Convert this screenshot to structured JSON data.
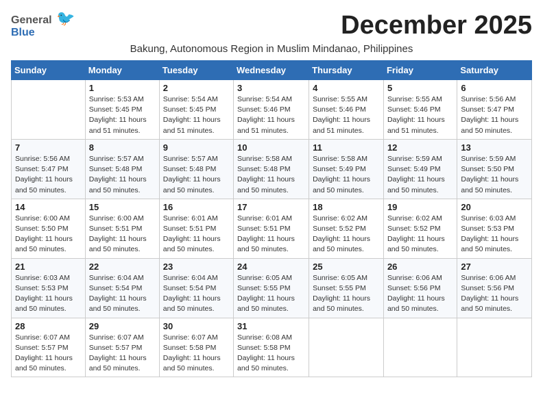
{
  "header": {
    "logo_general": "General",
    "logo_blue": "Blue",
    "month_title": "December 2025",
    "location": "Bakung, Autonomous Region in Muslim Mindanao, Philippines"
  },
  "days_of_week": [
    "Sunday",
    "Monday",
    "Tuesday",
    "Wednesday",
    "Thursday",
    "Friday",
    "Saturday"
  ],
  "weeks": [
    [
      {
        "day": "",
        "sunrise": "",
        "sunset": "",
        "daylight": ""
      },
      {
        "day": "1",
        "sunrise": "Sunrise: 5:53 AM",
        "sunset": "Sunset: 5:45 PM",
        "daylight": "Daylight: 11 hours and 51 minutes."
      },
      {
        "day": "2",
        "sunrise": "Sunrise: 5:54 AM",
        "sunset": "Sunset: 5:45 PM",
        "daylight": "Daylight: 11 hours and 51 minutes."
      },
      {
        "day": "3",
        "sunrise": "Sunrise: 5:54 AM",
        "sunset": "Sunset: 5:46 PM",
        "daylight": "Daylight: 11 hours and 51 minutes."
      },
      {
        "day": "4",
        "sunrise": "Sunrise: 5:55 AM",
        "sunset": "Sunset: 5:46 PM",
        "daylight": "Daylight: 11 hours and 51 minutes."
      },
      {
        "day": "5",
        "sunrise": "Sunrise: 5:55 AM",
        "sunset": "Sunset: 5:46 PM",
        "daylight": "Daylight: 11 hours and 51 minutes."
      },
      {
        "day": "6",
        "sunrise": "Sunrise: 5:56 AM",
        "sunset": "Sunset: 5:47 PM",
        "daylight": "Daylight: 11 hours and 50 minutes."
      }
    ],
    [
      {
        "day": "7",
        "sunrise": "Sunrise: 5:56 AM",
        "sunset": "Sunset: 5:47 PM",
        "daylight": "Daylight: 11 hours and 50 minutes."
      },
      {
        "day": "8",
        "sunrise": "Sunrise: 5:57 AM",
        "sunset": "Sunset: 5:48 PM",
        "daylight": "Daylight: 11 hours and 50 minutes."
      },
      {
        "day": "9",
        "sunrise": "Sunrise: 5:57 AM",
        "sunset": "Sunset: 5:48 PM",
        "daylight": "Daylight: 11 hours and 50 minutes."
      },
      {
        "day": "10",
        "sunrise": "Sunrise: 5:58 AM",
        "sunset": "Sunset: 5:48 PM",
        "daylight": "Daylight: 11 hours and 50 minutes."
      },
      {
        "day": "11",
        "sunrise": "Sunrise: 5:58 AM",
        "sunset": "Sunset: 5:49 PM",
        "daylight": "Daylight: 11 hours and 50 minutes."
      },
      {
        "day": "12",
        "sunrise": "Sunrise: 5:59 AM",
        "sunset": "Sunset: 5:49 PM",
        "daylight": "Daylight: 11 hours and 50 minutes."
      },
      {
        "day": "13",
        "sunrise": "Sunrise: 5:59 AM",
        "sunset": "Sunset: 5:50 PM",
        "daylight": "Daylight: 11 hours and 50 minutes."
      }
    ],
    [
      {
        "day": "14",
        "sunrise": "Sunrise: 6:00 AM",
        "sunset": "Sunset: 5:50 PM",
        "daylight": "Daylight: 11 hours and 50 minutes."
      },
      {
        "day": "15",
        "sunrise": "Sunrise: 6:00 AM",
        "sunset": "Sunset: 5:51 PM",
        "daylight": "Daylight: 11 hours and 50 minutes."
      },
      {
        "day": "16",
        "sunrise": "Sunrise: 6:01 AM",
        "sunset": "Sunset: 5:51 PM",
        "daylight": "Daylight: 11 hours and 50 minutes."
      },
      {
        "day": "17",
        "sunrise": "Sunrise: 6:01 AM",
        "sunset": "Sunset: 5:51 PM",
        "daylight": "Daylight: 11 hours and 50 minutes."
      },
      {
        "day": "18",
        "sunrise": "Sunrise: 6:02 AM",
        "sunset": "Sunset: 5:52 PM",
        "daylight": "Daylight: 11 hours and 50 minutes."
      },
      {
        "day": "19",
        "sunrise": "Sunrise: 6:02 AM",
        "sunset": "Sunset: 5:52 PM",
        "daylight": "Daylight: 11 hours and 50 minutes."
      },
      {
        "day": "20",
        "sunrise": "Sunrise: 6:03 AM",
        "sunset": "Sunset: 5:53 PM",
        "daylight": "Daylight: 11 hours and 50 minutes."
      }
    ],
    [
      {
        "day": "21",
        "sunrise": "Sunrise: 6:03 AM",
        "sunset": "Sunset: 5:53 PM",
        "daylight": "Daylight: 11 hours and 50 minutes."
      },
      {
        "day": "22",
        "sunrise": "Sunrise: 6:04 AM",
        "sunset": "Sunset: 5:54 PM",
        "daylight": "Daylight: 11 hours and 50 minutes."
      },
      {
        "day": "23",
        "sunrise": "Sunrise: 6:04 AM",
        "sunset": "Sunset: 5:54 PM",
        "daylight": "Daylight: 11 hours and 50 minutes."
      },
      {
        "day": "24",
        "sunrise": "Sunrise: 6:05 AM",
        "sunset": "Sunset: 5:55 PM",
        "daylight": "Daylight: 11 hours and 50 minutes."
      },
      {
        "day": "25",
        "sunrise": "Sunrise: 6:05 AM",
        "sunset": "Sunset: 5:55 PM",
        "daylight": "Daylight: 11 hours and 50 minutes."
      },
      {
        "day": "26",
        "sunrise": "Sunrise: 6:06 AM",
        "sunset": "Sunset: 5:56 PM",
        "daylight": "Daylight: 11 hours and 50 minutes."
      },
      {
        "day": "27",
        "sunrise": "Sunrise: 6:06 AM",
        "sunset": "Sunset: 5:56 PM",
        "daylight": "Daylight: 11 hours and 50 minutes."
      }
    ],
    [
      {
        "day": "28",
        "sunrise": "Sunrise: 6:07 AM",
        "sunset": "Sunset: 5:57 PM",
        "daylight": "Daylight: 11 hours and 50 minutes."
      },
      {
        "day": "29",
        "sunrise": "Sunrise: 6:07 AM",
        "sunset": "Sunset: 5:57 PM",
        "daylight": "Daylight: 11 hours and 50 minutes."
      },
      {
        "day": "30",
        "sunrise": "Sunrise: 6:07 AM",
        "sunset": "Sunset: 5:58 PM",
        "daylight": "Daylight: 11 hours and 50 minutes."
      },
      {
        "day": "31",
        "sunrise": "Sunrise: 6:08 AM",
        "sunset": "Sunset: 5:58 PM",
        "daylight": "Daylight: 11 hours and 50 minutes."
      },
      {
        "day": "",
        "sunrise": "",
        "sunset": "",
        "daylight": ""
      },
      {
        "day": "",
        "sunrise": "",
        "sunset": "",
        "daylight": ""
      },
      {
        "day": "",
        "sunrise": "",
        "sunset": "",
        "daylight": ""
      }
    ]
  ]
}
